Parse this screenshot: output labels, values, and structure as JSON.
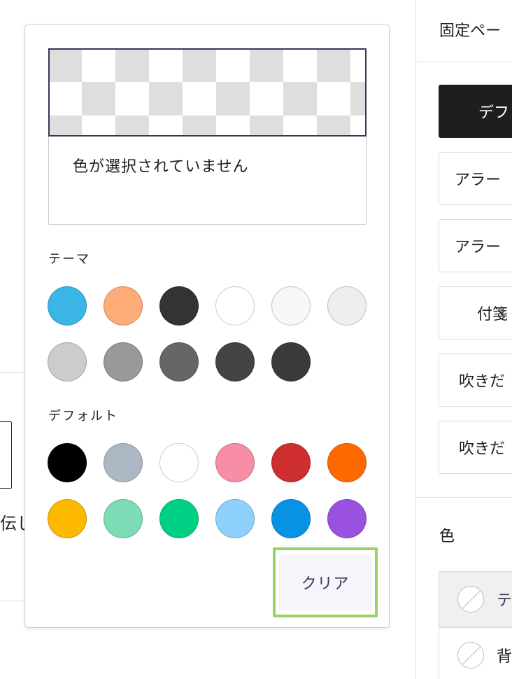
{
  "background": {
    "partial_text": "伝し"
  },
  "sidebar": {
    "heading": "固定ペー",
    "styles": [
      {
        "label": "デフ",
        "active": true
      },
      {
        "label": "アラー",
        "active": false
      },
      {
        "label": "アラー",
        "active": false
      },
      {
        "label": "付箋",
        "active": false
      },
      {
        "label": "吹きだ",
        "active": false
      },
      {
        "label": "吹きだ",
        "active": false
      }
    ],
    "color_label": "色",
    "color_rows": [
      {
        "label": "テ"
      },
      {
        "label": "背"
      }
    ]
  },
  "picker": {
    "no_color_text": "色が選択されていません",
    "theme_label": "テーマ",
    "default_label": "デフォルト",
    "clear_label": "クリア",
    "theme_colors": [
      "#3ab5e6",
      "#fdab77",
      "#333333",
      "#ffffff",
      "#f7f7f7",
      "#eeeeee",
      "#cccccc",
      "#999999",
      "#666666",
      "#444444",
      "#3a3a3a"
    ],
    "default_colors": [
      "#000000",
      "#abb8c3",
      "#ffffff",
      "#f78da7",
      "#cf2e2e",
      "#ff6900",
      "#fcb900",
      "#7bdcb5",
      "#00d084",
      "#8ed1fc",
      "#0693e3",
      "#9b51e0"
    ]
  },
  "colors": {
    "accent": "#3c3458",
    "highlight": "#97d362"
  }
}
